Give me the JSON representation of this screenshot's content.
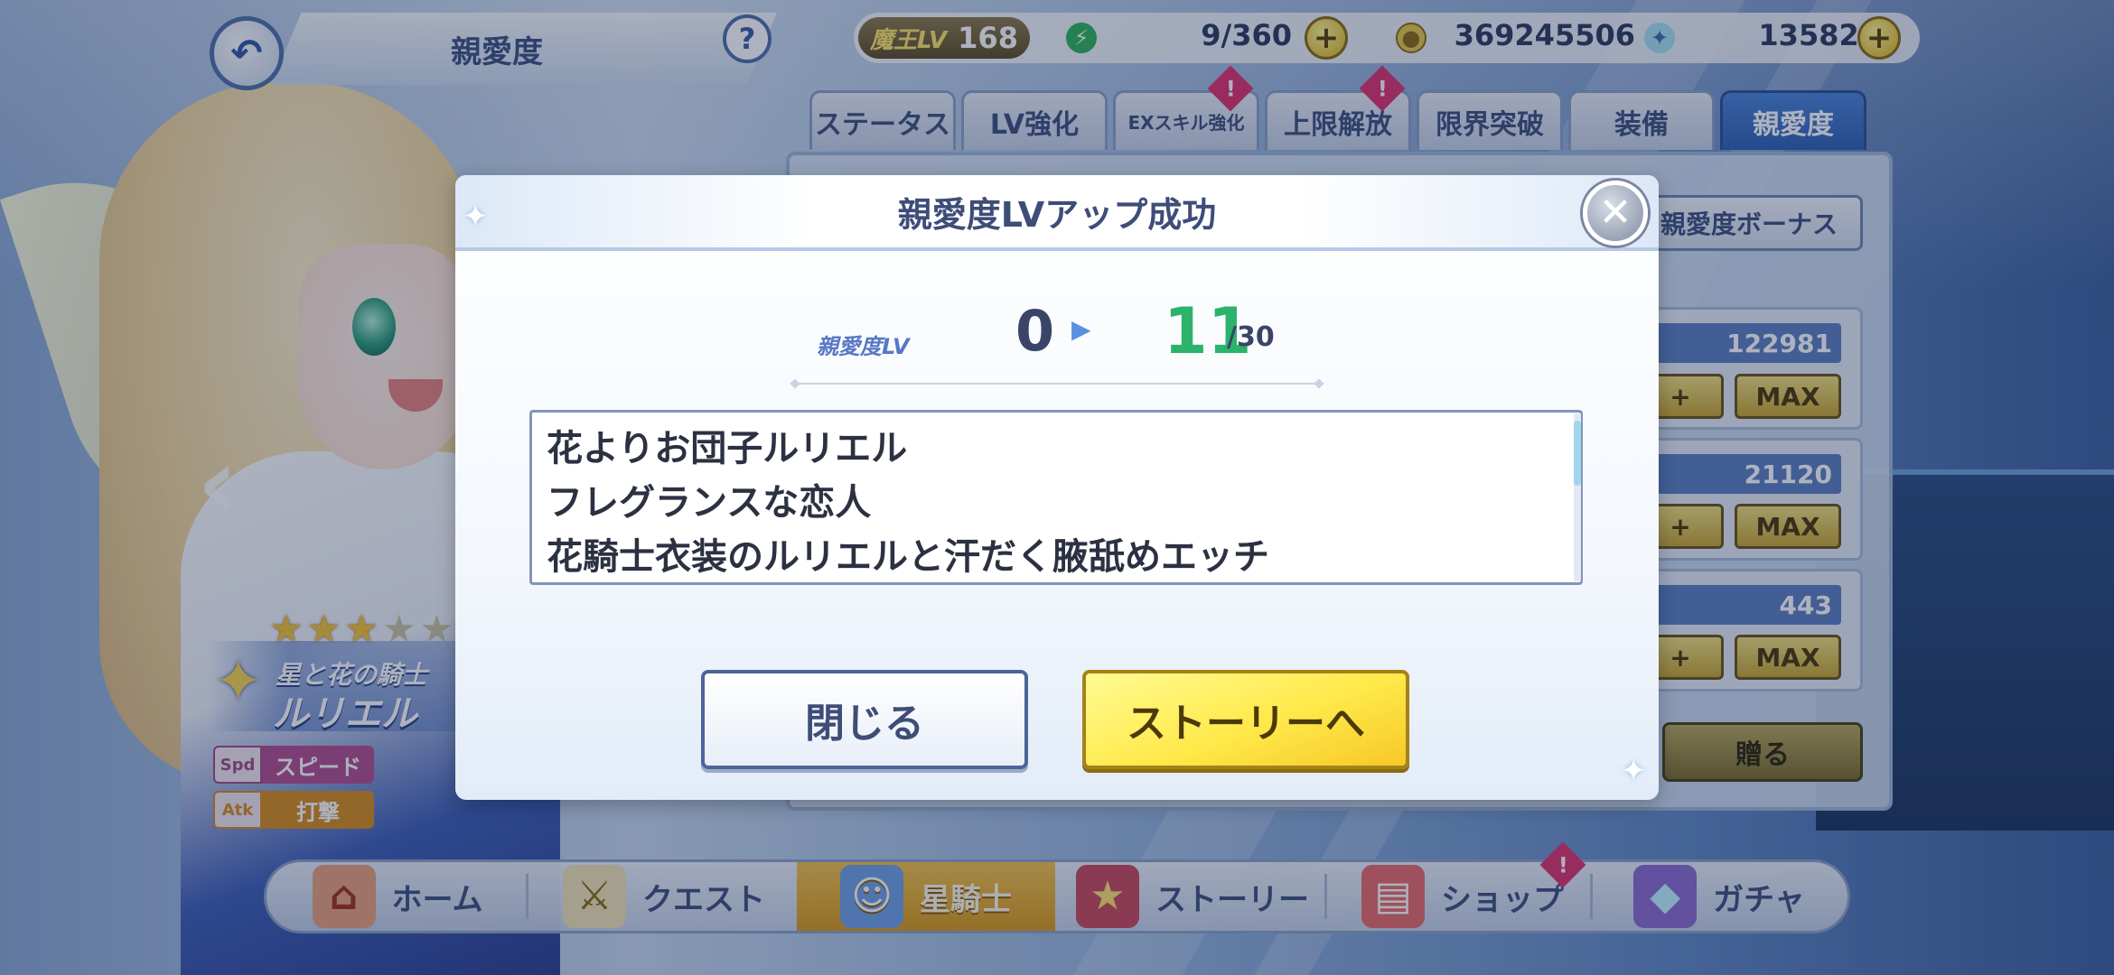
{
  "topbar": {
    "title": "親愛度",
    "help": "?",
    "player_level_label": "魔王LV",
    "player_level": "168",
    "stamina": "9/360",
    "coins": "369245506",
    "gems": "135820",
    "plus": "+"
  },
  "tabs": [
    {
      "label": "ステータス"
    },
    {
      "label": "LV強化"
    },
    {
      "label": "EXスキル強化"
    },
    {
      "label": "上限解放"
    },
    {
      "label": "限界突破"
    },
    {
      "label": "装備"
    },
    {
      "label": "親愛度"
    }
  ],
  "tab_badge": "!",
  "panel": {
    "bonus_button": "親愛度ボーナス",
    "stats": [
      {
        "value": "122981",
        "plus": "+",
        "max": "MAX"
      },
      {
        "value": "21120",
        "plus": "+",
        "max": "MAX"
      },
      {
        "value": "443",
        "plus": "+",
        "max": "MAX"
      }
    ],
    "gift_button": "贈る"
  },
  "character": {
    "stars_total": 5,
    "stars_filled": 3,
    "title": "星と花の騎士",
    "name": "ルリエル",
    "attributes": [
      {
        "icon": "Spd",
        "label": "スピード",
        "color": "#b24e8e"
      },
      {
        "icon": "Atk",
        "label": "打撃",
        "color": "#d78a1c"
      }
    ]
  },
  "modal": {
    "title": "親愛度LVアップ成功",
    "close": "✕",
    "level_caption": "親愛度LV",
    "level_from": "0",
    "level_to": "11",
    "level_max": "/30",
    "stories": [
      "花よりお団子ルリエル",
      "フレグランスな恋人",
      "花騎士衣装のルリエルと汗だく腋舐めエッチ"
    ],
    "close_button": "閉じる",
    "story_button": "ストーリーへ"
  },
  "nav": {
    "items": [
      {
        "label": "ホーム",
        "icon": "home-icon"
      },
      {
        "label": "クエスト",
        "icon": "quest-icon"
      },
      {
        "label": "星騎士",
        "icon": "knight-icon"
      },
      {
        "label": "ストーリー",
        "icon": "story-book-icon"
      },
      {
        "label": "ショップ",
        "icon": "shop-icon"
      },
      {
        "label": "ガチャ",
        "icon": "gacha-icon"
      }
    ],
    "active_index": 2,
    "shop_badge": "!"
  },
  "colors": {
    "accent_gold": "#f6c828",
    "accent_green": "#2bb36c",
    "accent_blue": "#3e4d78"
  }
}
